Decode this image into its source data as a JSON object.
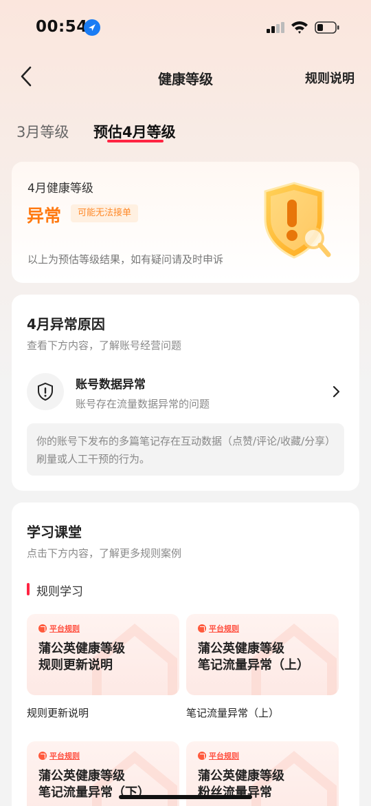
{
  "status_bar": {
    "time": "00:54"
  },
  "nav": {
    "title": "健康等级",
    "rules": "规则说明"
  },
  "tabs": [
    {
      "label": "3月等级",
      "active": false
    },
    {
      "label": "预估4月等级",
      "active": true
    }
  ],
  "level_card": {
    "title": "4月健康等级",
    "status": "异常",
    "badge": "可能无法接单",
    "note": "以上为预估等级结果，如有疑问请及时申诉"
  },
  "reason_card": {
    "title": "4月异常原因",
    "subtitle": "查看下方内容，了解账号经营问题",
    "item": {
      "title": "账号数据异常",
      "desc": "账号存在流量数据异常的问题",
      "detail": "你的账号下发布的多篇笔记存在互动数据（点赞/评论/收藏/分享）刷量或人工干预的行为。"
    }
  },
  "learn_card": {
    "title": "学习课堂",
    "subtitle": "点击下方内容，了解更多规则案例",
    "section": "规则学习",
    "tiles": [
      {
        "tag": "平台规则",
        "line1": "蒲公英健康等级",
        "line2": "规则更新说明",
        "caption": "规则更新说明"
      },
      {
        "tag": "平台规则",
        "line1": "蒲公英健康等级",
        "line2": "笔记流量异常（上）",
        "caption": "笔记流量异常（上）"
      },
      {
        "tag": "平台规则",
        "line1": "蒲公英健康等级",
        "line2": "笔记流量异常（下）"
      },
      {
        "tag": "平台规则",
        "line1": "蒲公英健康等级",
        "line2": "粉丝流量异常"
      }
    ]
  },
  "colors": {
    "accent": "#ff2442",
    "warning": "#ff7a12"
  }
}
